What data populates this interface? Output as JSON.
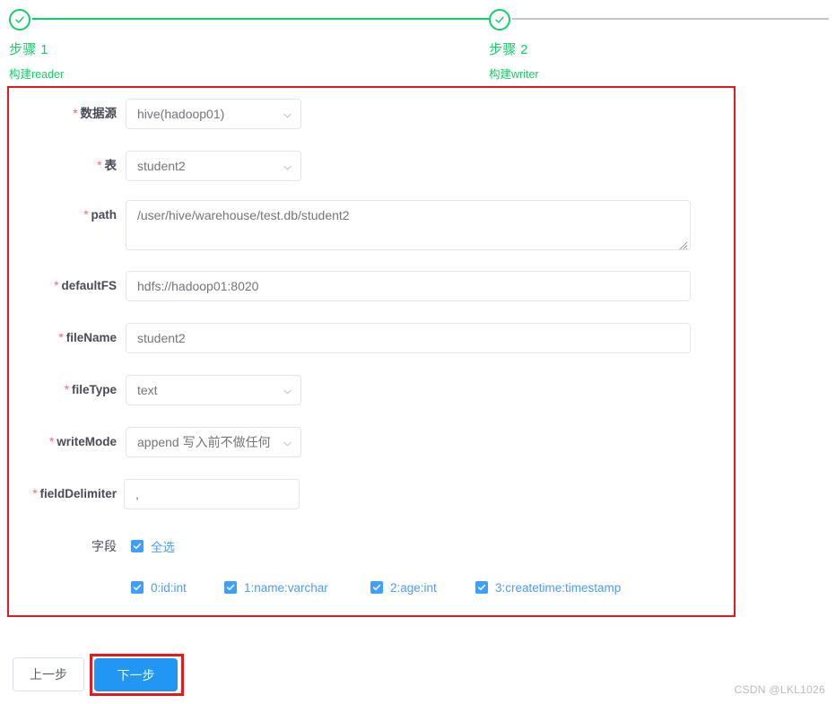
{
  "steps": [
    {
      "title": "步骤 1",
      "desc": "构建reader",
      "state": "done"
    },
    {
      "title": "步骤 2",
      "desc": "构建writer",
      "state": "done"
    }
  ],
  "form": {
    "fields": [
      {
        "key": "datasource",
        "label": "数据源",
        "required": true,
        "type": "select",
        "value": "hive(hadoop01)"
      },
      {
        "key": "table",
        "label": "表",
        "required": true,
        "type": "select",
        "value": "student2"
      },
      {
        "key": "path",
        "label": "path",
        "required": true,
        "type": "textarea",
        "value": "/user/hive/warehouse/test.db/student2"
      },
      {
        "key": "defaultFS",
        "label": "defaultFS",
        "required": true,
        "type": "input",
        "value": "hdfs://hadoop01:8020"
      },
      {
        "key": "fileName",
        "label": "fileName",
        "required": true,
        "type": "input",
        "value": "student2"
      },
      {
        "key": "fileType",
        "label": "fileType",
        "required": true,
        "type": "select",
        "value": "text"
      },
      {
        "key": "writeMode",
        "label": "writeMode",
        "required": true,
        "type": "select",
        "value": "append 写入前不做任何"
      },
      {
        "key": "delimiter",
        "label": "fieldDelimiter",
        "required": true,
        "type": "input",
        "value": ","
      }
    ],
    "columns": {
      "label": "字段",
      "select_all": {
        "label": "全选",
        "checked": true
      },
      "items": [
        {
          "label": "0:id:int",
          "checked": true
        },
        {
          "label": "1:name:varchar",
          "checked": true
        },
        {
          "label": "2:age:int",
          "checked": true
        },
        {
          "label": "3:createtime:timestamp",
          "checked": true
        }
      ]
    }
  },
  "footer": {
    "prev_label": "上一步",
    "next_label": "下一步"
  },
  "watermark": "CSDN @LKL1026",
  "colors": {
    "step_green": "#13ce66",
    "highlight_red": "#e4181f",
    "primary_blue": "#2196f3",
    "checkbox_blue": "#409eff",
    "link_blue": "#4b9cf8"
  }
}
